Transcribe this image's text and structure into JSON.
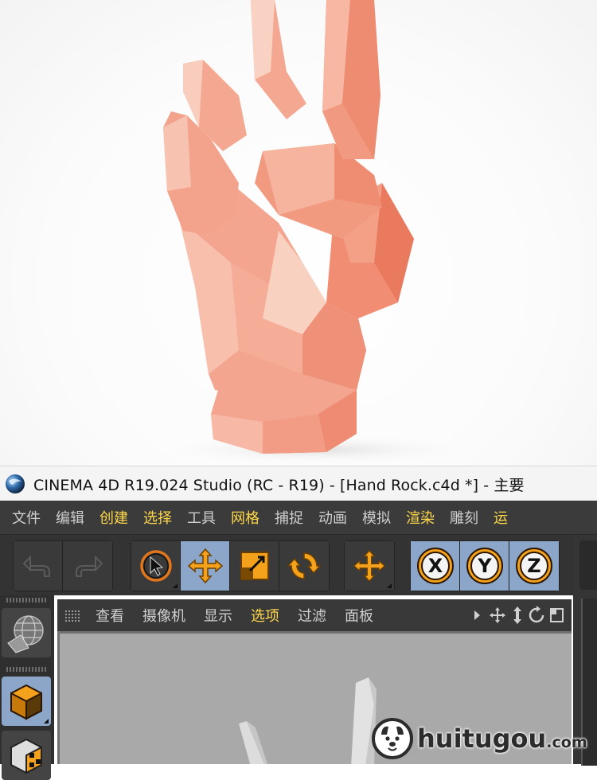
{
  "window": {
    "title": "CINEMA 4D R19.024 Studio (RC - R19) - [Hand Rock.c4d *] - 主要"
  },
  "menubar": {
    "items": [
      {
        "label": "文件",
        "highlight": false
      },
      {
        "label": "编辑",
        "highlight": false
      },
      {
        "label": "创建",
        "highlight": true
      },
      {
        "label": "选择",
        "highlight": true
      },
      {
        "label": "工具",
        "highlight": false
      },
      {
        "label": "网格",
        "highlight": true
      },
      {
        "label": "捕捉",
        "highlight": false
      },
      {
        "label": "动画",
        "highlight": false
      },
      {
        "label": "模拟",
        "highlight": false
      },
      {
        "label": "渲染",
        "highlight": true
      },
      {
        "label": "雕刻",
        "highlight": false
      },
      {
        "label": "运",
        "highlight": true
      }
    ]
  },
  "toolbar": {
    "history": [
      "undo-icon",
      "redo-icon"
    ],
    "tools": [
      "live-selection-icon",
      "move-icon",
      "scale-icon",
      "rotate-icon"
    ],
    "extra": [
      "coordinate-move-icon"
    ],
    "axes": [
      "X",
      "Y",
      "Z"
    ]
  },
  "viewport": {
    "menu": [
      {
        "label": "查看",
        "highlight": false
      },
      {
        "label": "摄像机",
        "highlight": false
      },
      {
        "label": "显示",
        "highlight": false
      },
      {
        "label": "选项",
        "highlight": true
      },
      {
        "label": "过滤",
        "highlight": false
      },
      {
        "label": "面板",
        "highlight": false
      }
    ],
    "nav_icons": [
      "arrow-right-icon",
      "pan-icon",
      "dolly-icon",
      "orbit-icon",
      "toggle-view-icon"
    ]
  },
  "left_palette": {
    "items": [
      "globe-mesh-icon",
      "model-mode-icon",
      "texture-mode-icon"
    ]
  },
  "watermark": {
    "brand": "huitugou",
    "suffix": ".com"
  },
  "colors": {
    "accent_yellow": "#ffd84a",
    "tool_orange": "#f4a21b",
    "active_blue": "#8ca6c9",
    "hand_salmon": "#f39a80"
  }
}
